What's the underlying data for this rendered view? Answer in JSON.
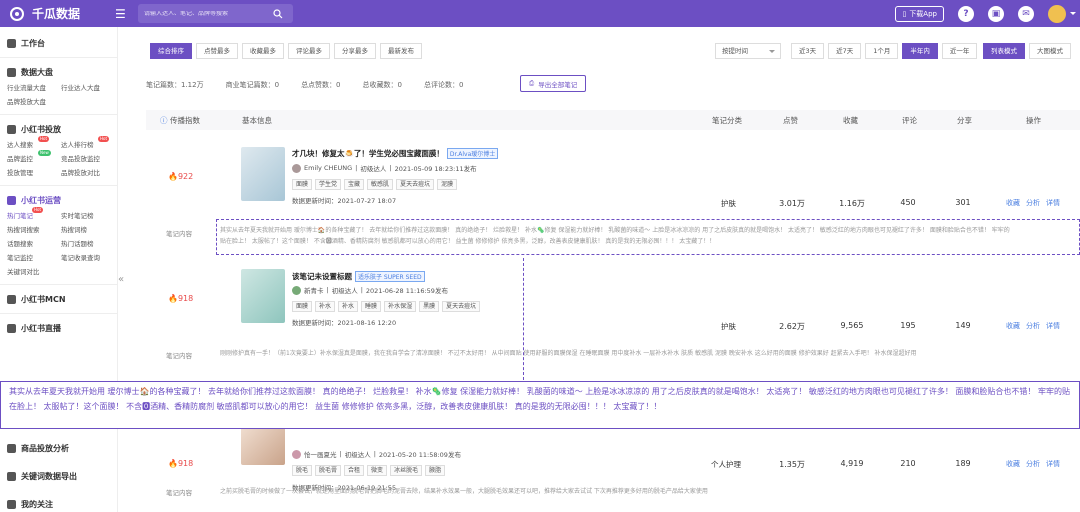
{
  "app": {
    "title": "千瓜数据",
    "search_placeholder": "请输入达人、笔记、品牌等搜索",
    "app_button": "下载App"
  },
  "sidebar": {
    "workbench": "工作台",
    "data_board": {
      "label": "数据大盘",
      "items": [
        "行业流量大盘",
        "行业达人大盘",
        "品牌投放大盘"
      ]
    },
    "xhs_ads": {
      "label": "小红书投放",
      "items": [
        "达人搜索",
        "达人排行榜",
        "品牌监控",
        "竞品投放监控",
        "投放管理",
        "品牌投放对比"
      ]
    },
    "xhs_ops": {
      "label": "小红书运营",
      "items": [
        "热门笔记",
        "实时笔记榜",
        "热搜词搜索",
        "热搜词榜",
        "话题搜索",
        "热门话题榜",
        "笔记监控",
        "笔记收录查询",
        "关键词对比"
      ]
    },
    "mcn": "小红书MCN",
    "live": "小红书直播",
    "product": "商品投放分析",
    "keyword_export": "关键词数据导出",
    "my_follow": "我的关注"
  },
  "filters": {
    "sort_tabs": [
      "综合排序",
      "点赞最多",
      "收藏最多",
      "评论最多",
      "分享最多",
      "最新发布"
    ],
    "sort_select": "按提时间",
    "time_tabs": [
      "近3天",
      "近7天",
      "1个月",
      "半年内",
      "近一年"
    ],
    "view_tabs": [
      "列表模式",
      "大图模式"
    ]
  },
  "stats": [
    "笔记篇数：1.12万",
    "商业笔记篇数：0",
    "总点赞数：0",
    "总收藏数：0",
    "总评论数：0"
  ],
  "export_label": "导出全部笔记",
  "columns": [
    "传播指数",
    "基本信息",
    "笔记分类",
    "点赞",
    "收藏",
    "评论",
    "分享",
    "操作"
  ],
  "rows": [
    {
      "rank": "922",
      "title": "才几块！修复太🍮了！学生党必囤宝藏面膜！",
      "badge": "Dr.Alva瑷尔博士",
      "author": "Emily CHEUNG",
      "level": "初级达人",
      "date": "2021-05-09 18:23:11发布",
      "tags": [
        "面膜",
        "学生党",
        "宝藏",
        "敏感肌",
        "夏天去痘坑",
        "泥膜"
      ],
      "updated": "数据更新时间：2021-07-27 18:07",
      "category": "护肤",
      "likes": "3.01万",
      "saves": "1.16万",
      "comments": "450",
      "shares": "301"
    },
    {
      "rank": "918",
      "title": "该笔记未设置标题",
      "badge": "适乐肤子 SUPER SEED",
      "author": "新青卡",
      "level": "初级达人",
      "date": "2021-06-28 11:16:59发布",
      "tags": [
        "面膜",
        "补水",
        "补水",
        "睡膜",
        "补水保湿",
        "黑膜",
        "夏天去痘坑"
      ],
      "updated": "数据更新时间：2021-08-16 12:20",
      "category": "护肤",
      "likes": "2.62万",
      "saves": "9,565",
      "comments": "195",
      "shares": "149"
    },
    {
      "rank": "918",
      "title": "",
      "badge": "",
      "author": "怆一画夏光",
      "level": "初级达人",
      "date": "2021-05-20 11:58:09发布",
      "tags": [
        "脱毛",
        "脱毛膏",
        "合租",
        "微变",
        "冰丝脱毛",
        "腋脂"
      ],
      "updated": "数据更新时间：2021-06-19 21:55",
      "category": "个人护理",
      "likes": "1.35万",
      "saves": "4,919",
      "comments": "210",
      "shares": "189"
    }
  ],
  "ops": [
    "收藏",
    "分析",
    "详情"
  ],
  "content_label": "笔记内容",
  "content1": "其实从去年夏天我就开始用 瑷尔博士🏠的各种宝藏了！ 去年就给你们推荐过这款面膜！ 真的绝绝子！ 烂脸救星！ 补水🦠修复 保湿能力就好棒！ 乳酸菌的味道～ 上脸是冰冰凉凉的 用了之后皮肤真的就是喝饱水！ 太适亮了！ 敏感泛红的地方肉眼也可见褪红了许多！ 面膜和脸贴合也不错！ 牢牢的贴在脸上！ 太服帖了！这个面膜！ 不含🅾酒精、香精防腐剂 敏感肌都可以放心的用它！ 益生菌 修修修护 依亮多黑，泛醇，改善表皮健康肌肤！ 真的是我的无限必囤！！！ 太宝藏了！！",
  "content2": "刚刚修护真有一手！（前1次竟要上）补水保湿真是面膜，我在我自学会了清凉面膜！ 不过不太好用！ 从中间面贴 使用舒服的面膜保湿 在睡眠面膜 用中度补水 一层补水补水 肤质 敏感肌 泥膜 晚安补水 这么好用的面膜 修护效果好 赶紧去入手吧！ 补水保湿超好用",
  "content3": "之前买脱毛膏的时候做了一次尝试，就是用里面的脱毛膏把脚毛的泥膏去除，结果补水效果一般，大腿脱毛效果还可以吧，推荐给大家去试试 下次再推荐更多好用的脱毛产品给大家使用"
}
